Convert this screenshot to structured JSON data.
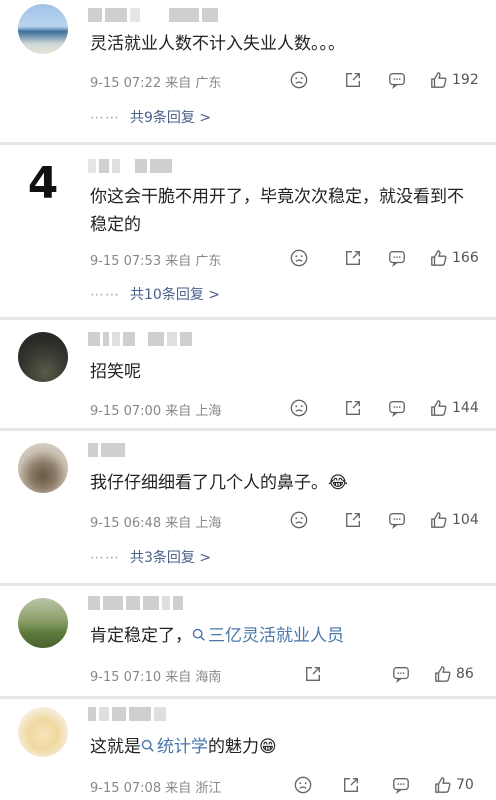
{
  "comments": [
    {
      "text": "灵活就业人数不计入失业人数。。。",
      "time": "9-15 07:22",
      "source": "来自 广东",
      "likes": "192",
      "replies": "共9条回复 >",
      "avatar": "beach-photo"
    },
    {
      "rank": "4",
      "text": "你这会干脆不用开了，毕竟次次稳定，就没看到不稳定的",
      "time": "9-15 07:53",
      "source": "来自 广东",
      "likes": "166",
      "replies": "共10条回复 >"
    },
    {
      "text": "招笑呢",
      "time": "9-15 07:00",
      "source": "来自 上海",
      "likes": "144",
      "avatar": "dark-landscape"
    },
    {
      "text": "我仔仔细细看了几个人的鼻子。",
      "emoji": "😂",
      "time": "9-15 06:48",
      "source": "来自 上海",
      "likes": "104",
      "replies": "共3条回复 >",
      "avatar": "pet-photo"
    },
    {
      "text_before": "肯定稳定了，",
      "link": "三亿灵活就业人员",
      "time": "9-15 07:10",
      "source": "来自 海南",
      "likes": "86",
      "avatar": "green-field"
    },
    {
      "text_before": "这就是",
      "link": "统计学",
      "text_after": "的魅力",
      "emoji": "😁",
      "time": "9-15 07:08",
      "source": "来自 浙江",
      "likes": "70",
      "avatar": "cartoon-cat"
    }
  ],
  "icons": [
    "smile-icon",
    "share-icon",
    "comment-icon",
    "like-icon",
    "search-link-icon"
  ],
  "colors": {
    "link": "#4a76a8",
    "meta": "#888888",
    "text": "#222222",
    "divider": "#e6e6e6"
  }
}
